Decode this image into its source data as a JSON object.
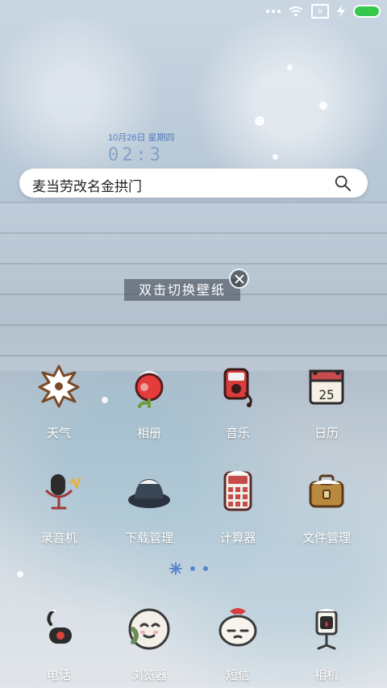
{
  "statusbar": {
    "icons": [
      "more-dots-icon",
      "wifi-icon",
      "sim-disabled-icon",
      "charging-icon",
      "battery-icon"
    ]
  },
  "clock_widget": {
    "date_text": "10月26日 星期四",
    "time_text": "02:3"
  },
  "search": {
    "text": "麦当劳改名金拱门"
  },
  "wallpaper_hint": {
    "text": "双击切换壁纸"
  },
  "apps": [
    {
      "label": "天气",
      "icon": "snowflake-icon"
    },
    {
      "label": "相册",
      "icon": "album-icon"
    },
    {
      "label": "音乐",
      "icon": "music-player-icon"
    },
    {
      "label": "日历",
      "icon": "calendar-icon",
      "day": "25"
    },
    {
      "label": "录音机",
      "icon": "microphone-icon"
    },
    {
      "label": "下载管理",
      "icon": "download-hat-icon"
    },
    {
      "label": "计算器",
      "icon": "calculator-icon"
    },
    {
      "label": "文件管理",
      "icon": "briefcase-icon"
    },
    {
      "label": "电话",
      "icon": "phone-icon"
    },
    {
      "label": "浏览器",
      "icon": "browser-face-icon"
    },
    {
      "label": "短信",
      "icon": "sms-face-icon"
    },
    {
      "label": "相机",
      "icon": "camera-icon"
    }
  ]
}
